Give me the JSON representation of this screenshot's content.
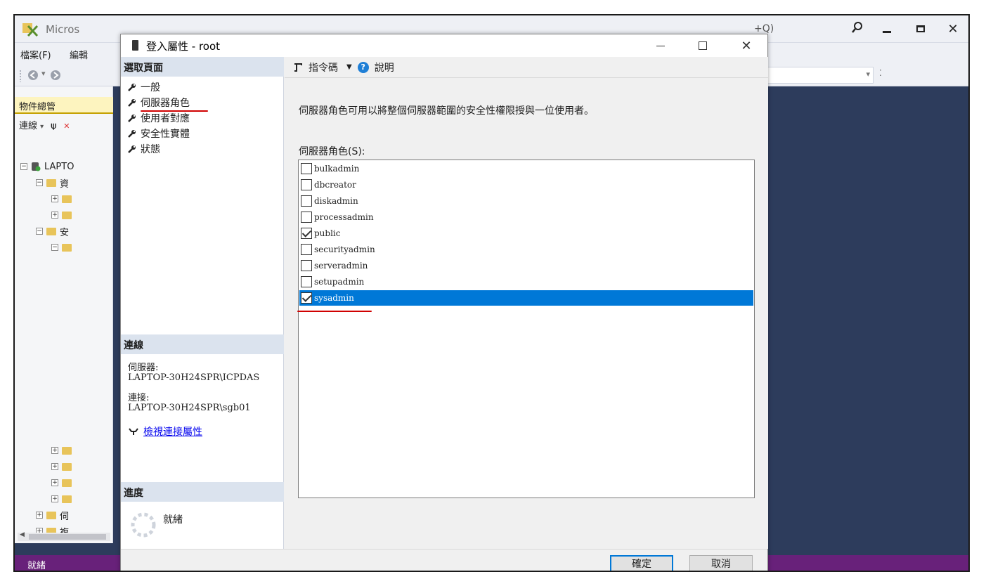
{
  "ssms": {
    "title_fragment": "Micros",
    "search_fragment": "+Q)",
    "menu": [
      "檔案(F)",
      "編輯"
    ],
    "statusbar": "就緒"
  },
  "explorer": {
    "header": "物件總管",
    "toolbar_label": "連線",
    "server_fragment": "LAPTO",
    "databases_fragment": "資",
    "security_fragment": "安",
    "server_objects_fragment": "伺",
    "replication_fragment": "複"
  },
  "dialog": {
    "title": "登入屬性 - root",
    "left_pane": {
      "select_page_header": "選取頁面",
      "pages": [
        "一般",
        "伺服器角色",
        "使用者對應",
        "安全性實體",
        "狀態"
      ],
      "connection_header": "連線",
      "server_label": "伺服器:",
      "server_value": "LAPTOP-30H24SPR\\ICPDAS",
      "connection_label": "連接:",
      "connection_value": "LAPTOP-30H24SPR\\sgb01",
      "view_connection_link": "檢視連接屬性",
      "progress_header": "進度",
      "progress_status": "就緒"
    },
    "toolbar": {
      "script_label": "指令碼",
      "help_label": "說明"
    },
    "description": "伺服器角色可用以將整個伺服器範圍的安全性權限授與一位使用者。",
    "roles_label": "伺服器角色(S):",
    "roles": [
      {
        "name": "bulkadmin",
        "checked": false
      },
      {
        "name": "dbcreator",
        "checked": false
      },
      {
        "name": "diskadmin",
        "checked": false
      },
      {
        "name": "processadmin",
        "checked": false
      },
      {
        "name": "public",
        "checked": true
      },
      {
        "name": "securityadmin",
        "checked": false
      },
      {
        "name": "serveradmin",
        "checked": false
      },
      {
        "name": "setupadmin",
        "checked": false
      },
      {
        "name": "sysadmin",
        "checked": true,
        "selected": true
      }
    ],
    "ok_label": "確定",
    "cancel_label": "取消"
  },
  "colors": {
    "selection": "#0078d7",
    "annotation_red": "#d00000",
    "statusbar": "#68217a",
    "workspace": "#2d3c5c"
  }
}
